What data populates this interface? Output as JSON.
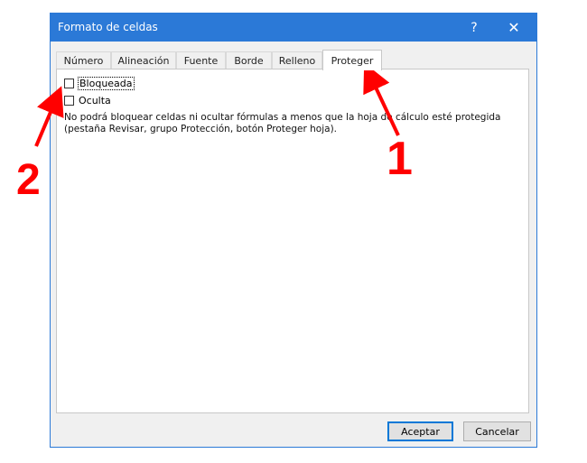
{
  "dialog": {
    "title": "Formato de celdas",
    "help_label": "?",
    "close_label": "✕"
  },
  "tabs": [
    {
      "label": "Número"
    },
    {
      "label": "Alineación"
    },
    {
      "label": "Fuente"
    },
    {
      "label": "Borde"
    },
    {
      "label": "Relleno"
    },
    {
      "label": "Proteger",
      "active": true
    }
  ],
  "protect": {
    "locked_label": "Bloqueada",
    "locked_checked": false,
    "hidden_label": "Oculta",
    "hidden_checked": false,
    "info_line1": "No podrá bloquear celdas ni ocultar fórmulas a menos que la hoja de cálculo esté protegida",
    "info_line2": "(pestaña Revisar, grupo Protección, botón Proteger hoja)."
  },
  "buttons": {
    "ok_label": "Aceptar",
    "cancel_label": "Cancelar"
  },
  "annotations": {
    "marker_1": "1",
    "marker_2": "2",
    "color": "#ff0000"
  },
  "colors": {
    "titlebar": "#2b79d7",
    "dialog_bg": "#f0f0f0"
  }
}
